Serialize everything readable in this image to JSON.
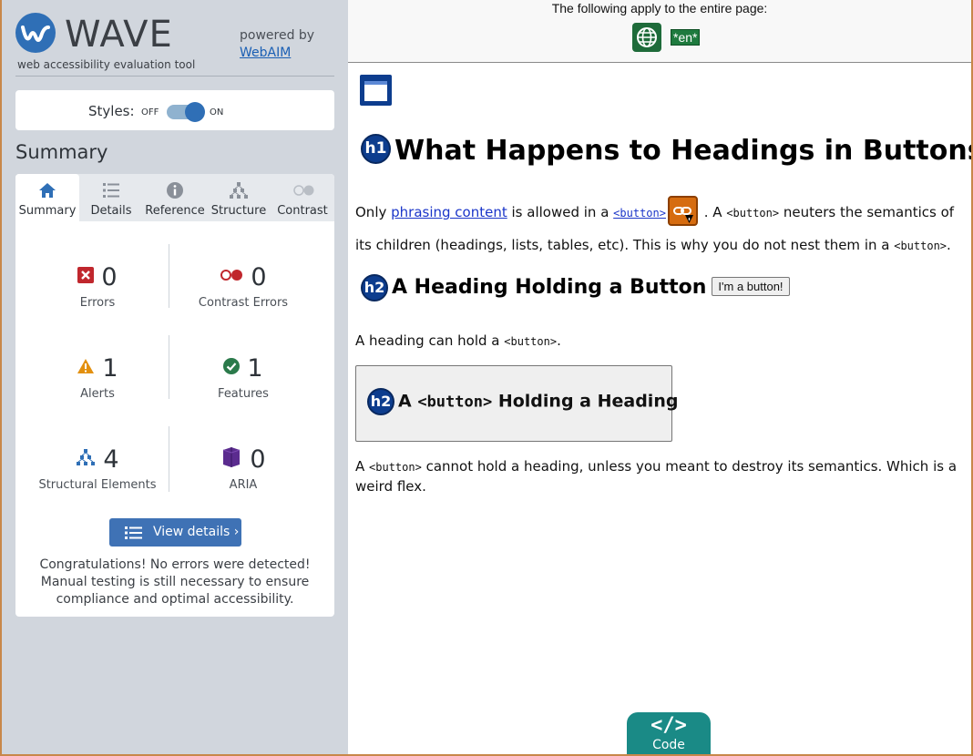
{
  "wave": {
    "brand": "WAVE",
    "tagline": "web accessibility evaluation tool",
    "powered_by": "powered by",
    "webaim": "WebAIM"
  },
  "styles_toggle": {
    "label": "Styles:",
    "off": "OFF",
    "on": "ON",
    "state": "on"
  },
  "summary": {
    "title": "Summary",
    "tabs": [
      {
        "label": "Summary",
        "icon": "home-icon",
        "active": true
      },
      {
        "label": "Details",
        "icon": "list-icon"
      },
      {
        "label": "Reference",
        "icon": "info-icon"
      },
      {
        "label": "Structure",
        "icon": "structure-icon"
      },
      {
        "label": "Contrast",
        "icon": "contrast-icon"
      }
    ],
    "stats": [
      {
        "count": "0",
        "label": "Errors",
        "icon": "error-icon",
        "color": "#c0272d"
      },
      {
        "count": "0",
        "label": "Contrast Errors",
        "icon": "contrast-error-icon",
        "color": "#c0272d"
      },
      {
        "count": "1",
        "label": "Alerts",
        "icon": "alert-icon",
        "color": "#e3900f"
      },
      {
        "count": "1",
        "label": "Features",
        "icon": "feature-icon",
        "color": "#2b7a4b"
      },
      {
        "count": "4",
        "label": "Structural Elements",
        "icon": "structural-icon",
        "color": "#2f6fb6"
      },
      {
        "count": "0",
        "label": "ARIA",
        "icon": "aria-icon",
        "color": "#5b2c8f"
      }
    ],
    "view_details": "View details ›",
    "congrats": "Congratulations! No errors were detected! Manual testing is still necessary to ensure compliance and optimal accessibility."
  },
  "page": {
    "top_notice": "The following apply to the entire page:",
    "lang_badge": "*en*",
    "h1_badge": "h1",
    "h1": "What Happens to Headings in Buttons",
    "p1": {
      "t1": "Only ",
      "link": "phrasing content",
      "t2": " is allowed in a ",
      "code1": "<button>",
      "t3": " . A ",
      "code2": "<button>",
      "t4": " neuters the semantics of its children (headings, lists, tables, etc). This is why you do not nest them in a ",
      "code3": "<button>",
      "t5": "."
    },
    "h2_badge": "h2",
    "h2": "A Heading Holding a Button",
    "inline_button": "I'm a button!",
    "p2": {
      "t1": "A heading can hold a ",
      "code": "<button>",
      "t2": "."
    },
    "button_heading": {
      "badge": "h2",
      "t1": "A ",
      "code": "<button>",
      "t2": " Holding a Heading"
    },
    "p3": {
      "t1": "A ",
      "code": "<button>",
      "t2": " cannot hold a heading, unless you meant to destroy its semantics. Which is a weird flex."
    },
    "code_tab": {
      "icon": "</>",
      "label": "Code"
    }
  },
  "colors": {
    "sidebar_bg": "#d1d6dd",
    "wave_blue": "#2f6fb6",
    "heading_badge": "#0d3d8e",
    "link": "#1a35c9",
    "code_tab": "#1a8a86"
  }
}
